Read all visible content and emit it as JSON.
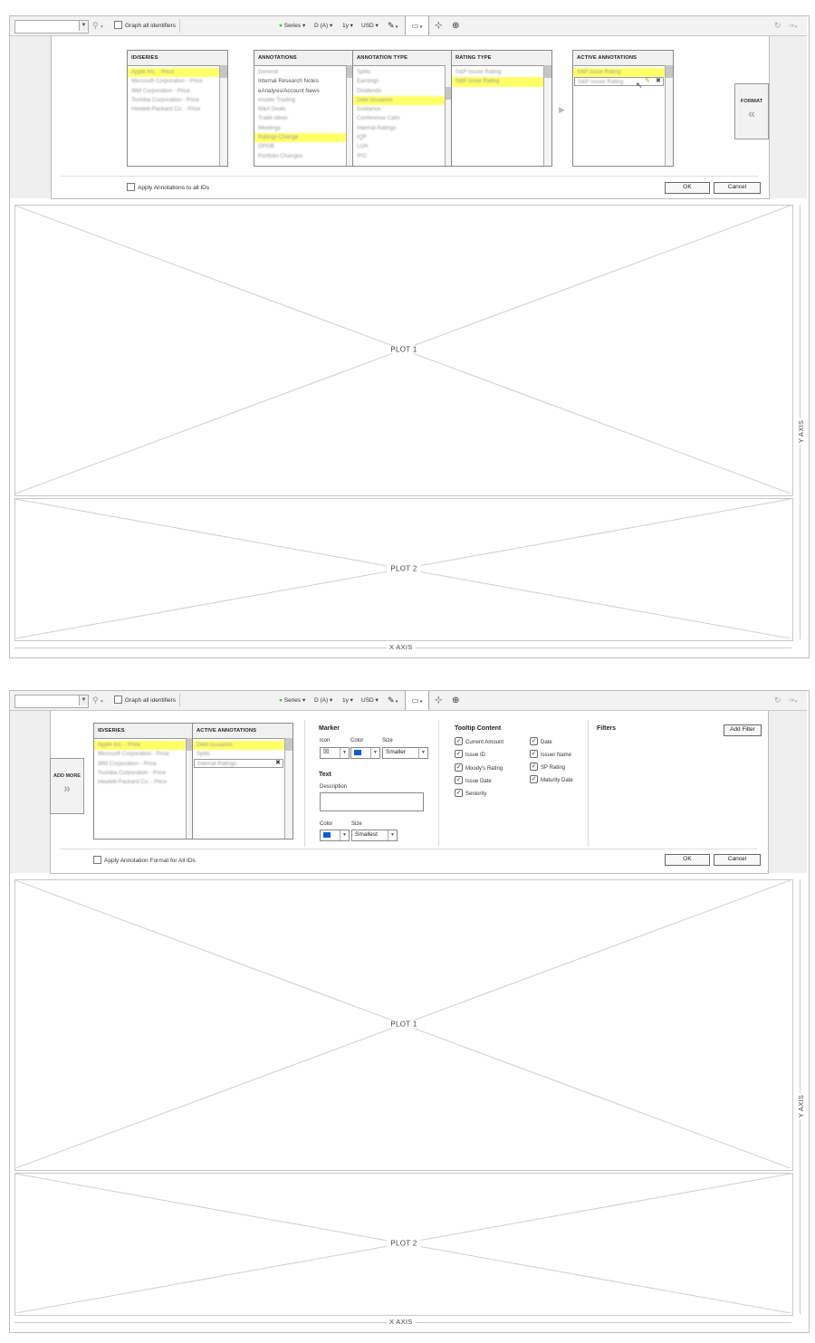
{
  "screen1": {
    "toolbar": {
      "graph_all_label": "Graph all identifiers",
      "series": "Series",
      "dateset": "D (A)",
      "period": "1y",
      "currency": "USD"
    },
    "panel": {
      "col_id_series": "ID/SERIES",
      "id_series_items": [
        "Apple Inc. - Price",
        "Microsoft Corporation - Price",
        "IBM Corporation - Price",
        "Toshiba Corporation - Price",
        "Hewlett-Packard Co. - Price"
      ],
      "col_annotations": "ANNOTATIONS",
      "annotations_items": [
        "General",
        "Internal Research Notes",
        "eAnalysis/Account News",
        "Insider Trading",
        "M&A Deals",
        "Trade Ideas",
        "Meetings",
        "Ratings Change",
        "OPOB",
        "Portfolio Changes"
      ],
      "col_annotation_type": "ANNOTATION TYPE",
      "annotation_type_items": [
        "Splits",
        "Earnings",
        "Dividends",
        "Debt Issuance",
        "Guidance",
        "Conference Calls",
        "Internal Ratings",
        "IQP",
        "LOA",
        "IPO"
      ],
      "col_rating_type": "RATING TYPE",
      "rating_type_items": [
        "S&P Issuer Rating",
        "S&P Issue Rating"
      ],
      "col_active": "ACTIVE ANNOTATIONS",
      "active_items": [
        "S&P Issue Rating",
        "S&P Issuer Rating"
      ],
      "format_label": "FORMAT",
      "apply_all_label": "Apply Annotations to all IDs",
      "ok": "OK",
      "cancel": "Cancel"
    },
    "plot1": "PLOT 1",
    "plot2": "PLOT 2",
    "x_axis": "X AXIS",
    "y_axis": "Y AXIS"
  },
  "screen2": {
    "toolbar": {
      "graph_all_label": "Graph all identifiers",
      "series": "Series",
      "dateset": "D (A)",
      "period": "1y",
      "currency": "USD"
    },
    "panel": {
      "add_more_label": "ADD MORE",
      "col_id_series": "ID/SERIES",
      "id_series_items": [
        "Apple Inc. - Price",
        "Microsoft Corporation - Price",
        "IBM Corporation - Price",
        "Toshiba Corporation - Price",
        "Hewlett-Packard Co. - Price"
      ],
      "col_active": "ACTIVE ANNOTATIONS",
      "active_items": [
        "Debt Issuance",
        "Splits",
        "Internal Ratings"
      ],
      "marker_title": "Marker",
      "icon_label": "Icon",
      "color_label": "Color",
      "size_label": "Size",
      "marker_size_value": "Smaller",
      "text_title": "Text",
      "description_label": "Description",
      "description_value": "",
      "text_color_label": "Color",
      "text_size_label": "Size",
      "text_size_value": "Smallest",
      "tooltip_title": "Tooltip Content",
      "tooltip_left": [
        "Current Amount",
        "Issue ID",
        "Moody's Rating",
        "Issue Date",
        "Seniority"
      ],
      "tooltip_right": [
        "Date",
        "Issuer Name",
        "SP Rating",
        "Maturity Date"
      ],
      "filters_title": "Filters",
      "add_filter": "Add Filter",
      "apply_all_label": "Apply Annotation Format for All IDs",
      "ok": "OK",
      "cancel": "Cancel"
    },
    "plot1": "PLOT 1",
    "plot2": "PLOT 2",
    "x_axis": "X AXIS",
    "y_axis": "Y AXIS"
  },
  "colors": {
    "highlight": "#ffff66",
    "marker_blue": "#0a5cd8",
    "border": "#bdbdbd"
  }
}
